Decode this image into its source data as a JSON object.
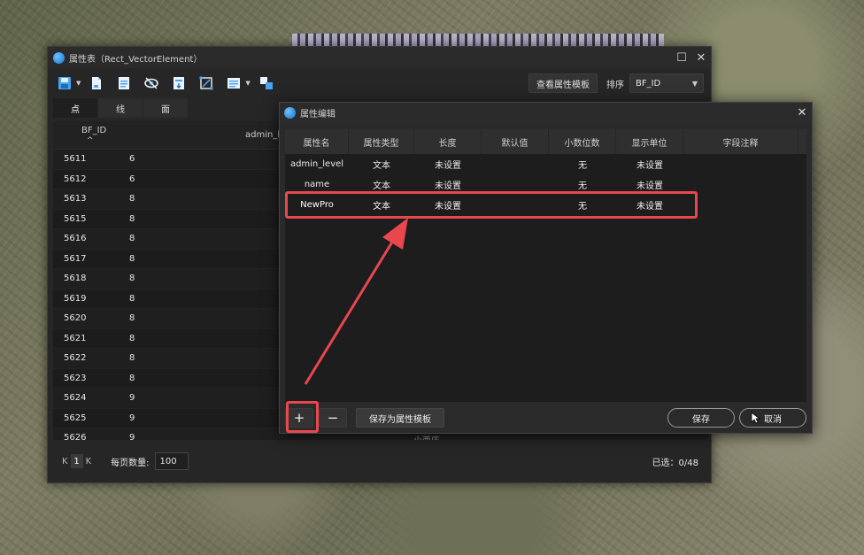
{
  "main_window": {
    "title": "属性表（Rect_VectorElement）",
    "toolbar": {
      "view_template_label": "查看属性模板",
      "sort_label": "排序",
      "sort_value": "BF_ID"
    },
    "tabs": [
      "点",
      "线",
      "面"
    ],
    "columns": {
      "id_header": "BF_ID",
      "sort_arrow": "^",
      "admin_level_header": "admin_le"
    },
    "rows": [
      {
        "id": "5611",
        "level": "6"
      },
      {
        "id": "5612",
        "level": "6"
      },
      {
        "id": "5613",
        "level": "8"
      },
      {
        "id": "5615",
        "level": "8"
      },
      {
        "id": "5616",
        "level": "8"
      },
      {
        "id": "5617",
        "level": "8"
      },
      {
        "id": "5618",
        "level": "8"
      },
      {
        "id": "5619",
        "level": "8"
      },
      {
        "id": "5620",
        "level": "8"
      },
      {
        "id": "5621",
        "level": "8"
      },
      {
        "id": "5622",
        "level": "8"
      },
      {
        "id": "5623",
        "level": "8"
      },
      {
        "id": "5624",
        "level": "9"
      },
      {
        "id": "5625",
        "level": "9"
      },
      {
        "id": "5626",
        "level": "9"
      }
    ],
    "ghost_cell_text": "小西庄",
    "footer": {
      "first_page": "K",
      "current_page": "1",
      "last_page": "K",
      "page_size_label": "每页数量:",
      "page_size_value": "100",
      "selected_text": "已选：0/48"
    }
  },
  "dialog": {
    "title": "属性编辑",
    "close": "✕",
    "headers": [
      "属性名",
      "属性类型",
      "长度",
      "默认值",
      "小数位数",
      "显示单位",
      "字段注释"
    ],
    "rows": [
      {
        "name": "admin_level",
        "type": "文本",
        "length": "未设置",
        "default": "",
        "decimals": "无",
        "unit": "未设置",
        "comment": ""
      },
      {
        "name": "name",
        "type": "文本",
        "length": "未设置",
        "default": "",
        "decimals": "无",
        "unit": "未设置",
        "comment": ""
      },
      {
        "name": "NewPro",
        "type": "文本",
        "length": "未设置",
        "default": "",
        "decimals": "无",
        "unit": "未设置",
        "comment": ""
      }
    ],
    "footer": {
      "add": "+",
      "remove": "−",
      "save_template": "保存为属性模板",
      "save": "保存",
      "cancel": "取消"
    }
  },
  "colors": {
    "highlight": "#e8474e",
    "panel": "#262626",
    "accent_blue": "#1674d1"
  }
}
